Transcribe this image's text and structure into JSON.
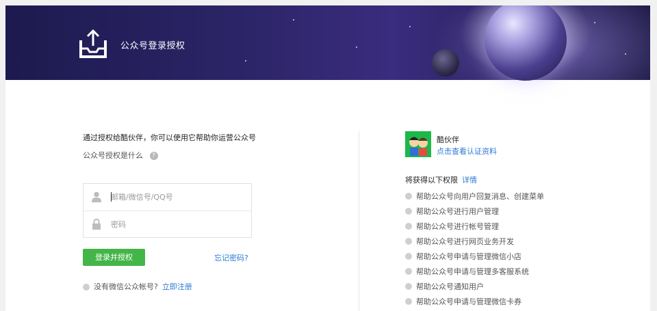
{
  "header": {
    "title": "公众号登录授权",
    "logo_icon": "upload-tray-icon"
  },
  "login": {
    "intro": "通过授权给酷伙伴，你可以使用它帮助你运营公众号",
    "what_is": "公众号授权是什么",
    "help_icon": "?",
    "account_placeholder": "邮箱/微信号/QQ号",
    "password_placeholder": "密码",
    "user_icon": "user-icon",
    "lock_icon": "lock-icon",
    "submit_label": "登录并授权",
    "forgot_label": "忘记密码?",
    "no_account_text": "没有微信公众帐号?",
    "register_label": "立即注册"
  },
  "partner": {
    "name": "酷伙伴",
    "view_link": "点击查看认证资料",
    "avatar_icon": "partner-avatar-icon"
  },
  "permissions": {
    "title": "将获得以下权限",
    "detail_label": "详情",
    "items": [
      "帮助公众号向用户回复消息、创建菜单",
      "帮助公众号进行用户管理",
      "帮助公众号进行帐号管理",
      "帮助公众号进行网页业务开发",
      "帮助公众号申请与管理微信小店",
      "帮助公众号申请与管理多客服系统",
      "帮助公众号通知用户",
      "帮助公众号申请与管理微信卡券"
    ]
  },
  "colors": {
    "accent_green": "#44b549",
    "link_blue": "#2d7ad6",
    "banner_dark": "#2b2466"
  }
}
